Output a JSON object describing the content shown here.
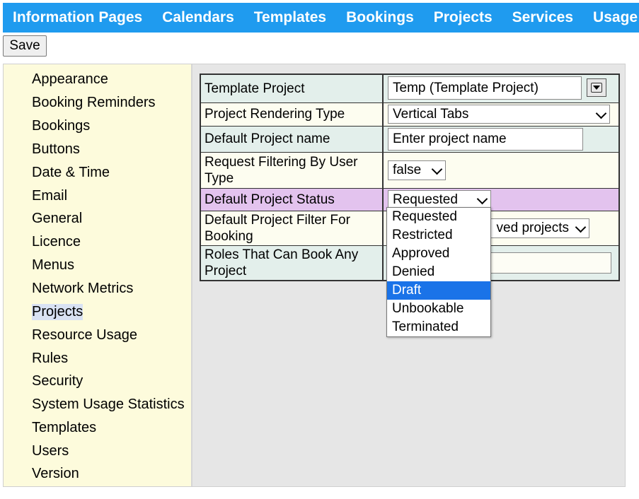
{
  "nav": [
    "Information Pages",
    "Calendars",
    "Templates",
    "Bookings",
    "Projects",
    "Services",
    "Usage"
  ],
  "save_label": "Save",
  "sidebar": [
    "Appearance",
    "Booking Reminders",
    "Bookings",
    "Buttons",
    "Date & Time",
    "Email",
    "General",
    "Licence",
    "Menus",
    "Network Metrics",
    "Projects",
    "Resource Usage",
    "Rules",
    "Security",
    "System Usage Statistics",
    "Templates",
    "Users",
    "Version"
  ],
  "sidebar_active": "Projects",
  "settings": {
    "template_project": {
      "label": "Template Project",
      "value": "Temp (Template Project)"
    },
    "rendering_type": {
      "label": "Project Rendering Type",
      "value": "Vertical Tabs"
    },
    "default_name": {
      "label": "Default Project name",
      "value": "Enter project name"
    },
    "request_filtering": {
      "label": "Request Filtering By User Type",
      "value": "false"
    },
    "default_status": {
      "label": "Default Project Status",
      "value": "Requested"
    },
    "filter_for_booking": {
      "label": "Default Project Filter For Booking",
      "value": "ved projects"
    },
    "roles_book_any": {
      "label": "Roles That Can Book Any Project",
      "value": ""
    }
  },
  "status_options": [
    "Requested",
    "Restricted",
    "Approved",
    "Denied",
    "Draft",
    "Unbookable",
    "Terminated"
  ],
  "status_highlighted": "Draft",
  "colors": {
    "nav": "#1f9bef",
    "sidebar": "#fdfbdc",
    "highlight": "#1a73e8",
    "purple_row": "#e3c3ee"
  }
}
